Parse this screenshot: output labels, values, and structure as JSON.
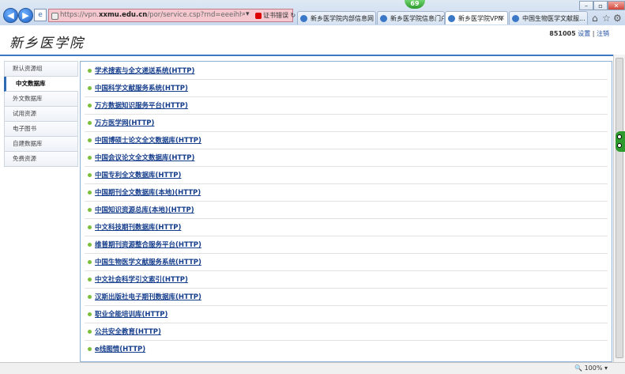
{
  "browser": {
    "url_prefix": "https://vpn.",
    "url_domain": "xxmu.edu.cn",
    "url_path": "/por/service.csp?rnd=eeeihhhboahgcnme",
    "cert_error": "证书错误",
    "badge": "69",
    "tabs": [
      {
        "label": "新乡医学院内部信息网"
      },
      {
        "label": "新乡医学院信息门户"
      },
      {
        "label": "新乡医学院VPN"
      },
      {
        "label": "中国生物医学文献服..."
      }
    ]
  },
  "header": {
    "logo": "新乡医学院",
    "user_id": "851005",
    "settings": "设置",
    "logout": "注销"
  },
  "sidebar": {
    "items": [
      {
        "label": "默认资源组"
      },
      {
        "label": "中文数据库"
      },
      {
        "label": "外文数据库"
      },
      {
        "label": "试用资源"
      },
      {
        "label": "电子图书"
      },
      {
        "label": "自建数据库"
      },
      {
        "label": "免费资源"
      }
    ]
  },
  "resources": [
    {
      "label": "学术搜索与全文递送系统(HTTP)"
    },
    {
      "label": "中国科学文献服务系统(HTTP)"
    },
    {
      "label": "万方数据知识服务平台(HTTP)"
    },
    {
      "label": "万方医学网(HTTP)"
    },
    {
      "label": "中国博硕士论文全文数据库(HTTP)"
    },
    {
      "label": "中国会议论文全文数据库(HTTP)"
    },
    {
      "label": "中国专利全文数据库(HTTP)"
    },
    {
      "label": "中国期刊全文数据库(本地)(HTTP)"
    },
    {
      "label": "中国知识资源总库(本地)(HTTP)"
    },
    {
      "label": "中文科技期刊数据库(HTTP)"
    },
    {
      "label": "维普期刊资源整合服务平台(HTTP)"
    },
    {
      "label": "中国生物医学文献服务系统(HTTP)"
    },
    {
      "label": "中文社会科学引文索引(HTTP)"
    },
    {
      "label": "汉斯出版社电子期刊数据库(HTTP)"
    },
    {
      "label": "职业全能培训库(HTTP)"
    },
    {
      "label": "公共安全教育(HTTP)"
    },
    {
      "label": "e线图情(HTTP)"
    }
  ],
  "status": {
    "zoom": "100%"
  }
}
